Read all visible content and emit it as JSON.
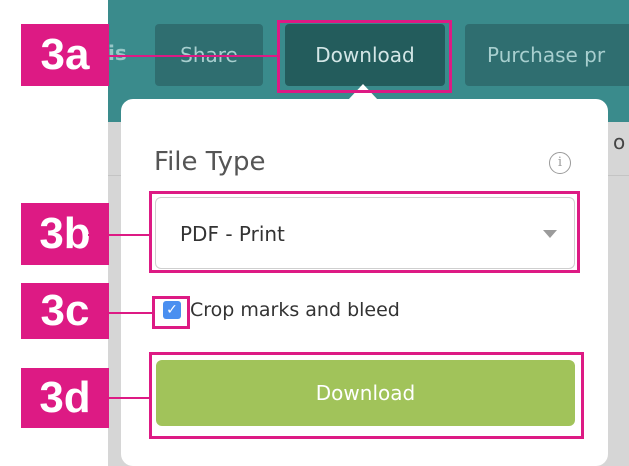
{
  "toolbar": {
    "partial_left": "is",
    "share_label": "Share",
    "download_label": "Download",
    "purchase_label": "Purchase pr"
  },
  "background": {
    "partial_text": "o"
  },
  "popover": {
    "title": "File Type",
    "info_icon": "i",
    "file_type_select": {
      "selected": "PDF - Print"
    },
    "crop_marks": {
      "label": "Crop marks and bleed",
      "checked": true,
      "check_glyph": "✓"
    },
    "download_button": "Download"
  },
  "annotations": [
    {
      "label": "3a"
    },
    {
      "label": "3b"
    },
    {
      "label": "3c"
    },
    {
      "label": "3d"
    }
  ],
  "colors": {
    "annotation": "#dd1a84",
    "toolbar": "#3a8b8c",
    "download_green": "#a1c35a",
    "checkbox_blue": "#4a8ff0"
  }
}
